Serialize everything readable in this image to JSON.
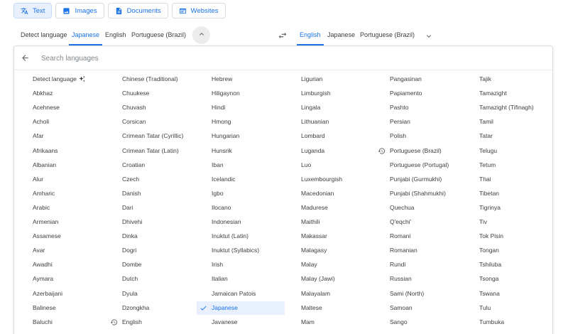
{
  "modes": [
    {
      "label": "Text",
      "icon": "translate-icon",
      "active": true
    },
    {
      "label": "Images",
      "icon": "image-icon",
      "active": false
    },
    {
      "label": "Documents",
      "icon": "document-icon",
      "active": false
    },
    {
      "label": "Websites",
      "icon": "website-icon",
      "active": false
    }
  ],
  "source_tabs": [
    {
      "label": "Detect language",
      "active": false
    },
    {
      "label": "Japanese",
      "active": true
    },
    {
      "label": "English",
      "active": false
    },
    {
      "label": "Portuguese (Brazil)",
      "active": false
    }
  ],
  "target_tabs": [
    {
      "label": "English",
      "active": true
    },
    {
      "label": "Japanese",
      "active": false
    },
    {
      "label": "Portuguese (Brazil)",
      "active": false
    }
  ],
  "search": {
    "placeholder": "Search languages",
    "value": ""
  },
  "accent_color": "#1a73e8",
  "selected_language": "Japanese",
  "languages": [
    [
      "Detect language",
      "Abkhaz",
      "Acehnese",
      "Acholi",
      "Afar",
      "Afrikaans",
      "Albanian",
      "Alur",
      "Amharic",
      "Arabic",
      "Armenian",
      "Assamese",
      "Avar",
      "Awadhi",
      "Aymara",
      "Azerbaijani",
      "Balinese",
      "Baluchi"
    ],
    [
      "Chinese (Traditional)",
      "Chuukese",
      "Chuvash",
      "Corsican",
      "Crimean Tatar (Cyrillic)",
      "Crimean Tatar (Latin)",
      "Croatian",
      "Czech",
      "Danish",
      "Dari",
      "Dhivehi",
      "Dinka",
      "Dogri",
      "Dombe",
      "Dutch",
      "Dyula",
      "Dzongkha",
      "English"
    ],
    [
      "Hebrew",
      "Hiligaynon",
      "Hindi",
      "Hmong",
      "Hungarian",
      "Hunsrik",
      "Iban",
      "Icelandic",
      "Igbo",
      "Ilocano",
      "Indonesian",
      "Inuktut (Latin)",
      "Inuktut (Syllabics)",
      "Irish",
      "Italian",
      "Jamaican Patois",
      "Japanese",
      "Javanese"
    ],
    [
      "Ligurian",
      "Limburgish",
      "Lingala",
      "Lithuanian",
      "Lombard",
      "Luganda",
      "Luo",
      "Luxembourgish",
      "Macedonian",
      "Madurese",
      "Maithili",
      "Makassar",
      "Malagasy",
      "Malay",
      "Malay (Jawi)",
      "Malayalam",
      "Maltese",
      "Mam"
    ],
    [
      "Pangasinan",
      "Papiamento",
      "Pashto",
      "Persian",
      "Polish",
      "Portuguese (Brazil)",
      "Portuguese (Portugal)",
      "Punjabi (Gurmukhi)",
      "Punjabi (Shahmukhi)",
      "Quechua",
      "Q'eqchi'",
      "Romani",
      "Romanian",
      "Rundi",
      "Russian",
      "Sami (North)",
      "Samoan",
      "Sango"
    ],
    [
      "Tajik",
      "Tamazight",
      "Tamazight (Tifinagh)",
      "Tamil",
      "Tatar",
      "Telugu",
      "Tetum",
      "Thai",
      "Tibetan",
      "Tigrinya",
      "Tiv",
      "Tok Pisin",
      "Tongan",
      "Tshiluba",
      "Tsonga",
      "Tswana",
      "Tulu",
      "Tumbuka"
    ]
  ],
  "recent_languages": [
    "English",
    "Portuguese (Brazil)"
  ],
  "detect_language_icon": "sparkle-icon",
  "recent_icon": "history-icon",
  "selected_icon": "check-icon"
}
